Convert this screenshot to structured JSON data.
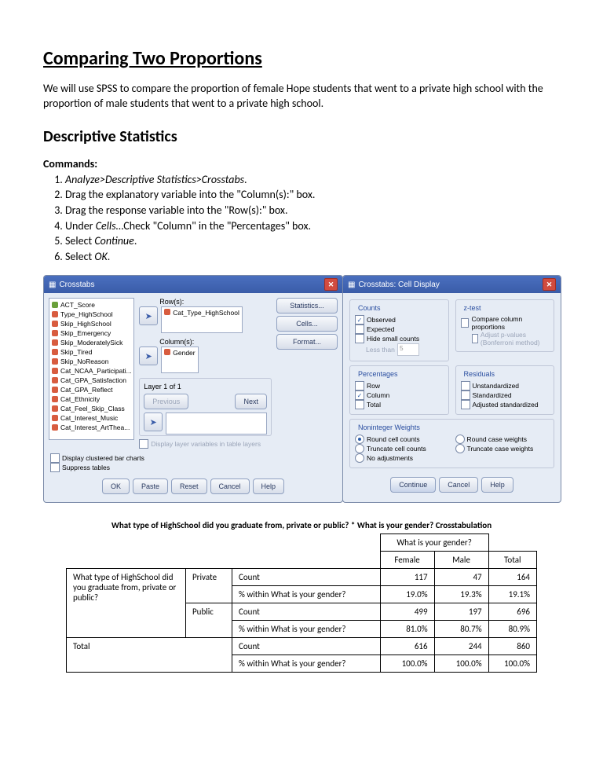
{
  "title": "Comparing Two Proportions",
  "intro": "We will use SPSS to compare the proportion of female Hope students that went to a private high school with the proportion of male students that went to a private high school.",
  "section_heading": "Descriptive Statistics",
  "commands_label": "Commands:",
  "commands": [
    {
      "pre": "",
      "it": "Analyze>Descriptive Statistics>Crosstabs",
      "post": "."
    },
    {
      "pre": "Drag the explanatory variable into the \"Column(s):\" box.",
      "it": "",
      "post": ""
    },
    {
      "pre": "Drag the response variable into the \"Row(s):\" box.",
      "it": "",
      "post": ""
    },
    {
      "pre": "Under ",
      "it": "Cells",
      "post": "…Check \"Column\" in the \"Percentages\" box."
    },
    {
      "pre": "Select ",
      "it": "Continue",
      "post": "."
    },
    {
      "pre": "Select ",
      "it": "OK",
      "post": "."
    }
  ],
  "crosstabs_dialog": {
    "title": "Crosstabs",
    "variables": [
      "ACT_Score",
      "Type_HighSchool",
      "Skip_HighSchool",
      "Skip_Emergency",
      "Skip_ModeratelySick",
      "Skip_Tired",
      "Skip_NoReason",
      "Cat_NCAA_Participati...",
      "Cat_GPA_Satisfaction",
      "Cat_GPA_Reflect",
      "Cat_Ethnicity",
      "Cat_Feel_Skip_Class",
      "Cat_Interest_Music",
      "Cat_Interest_ArtThea..."
    ],
    "rows_label": "Row(s):",
    "rows_value": "Cat_Type_HighSchool",
    "cols_label": "Column(s):",
    "cols_value": "Gender",
    "layer_label": "Layer 1 of 1",
    "btn_prev": "Previous",
    "btn_next": "Next",
    "chk_layer_vars": "Display layer variables in table layers",
    "chk_cluster": "Display clustered bar charts",
    "chk_suppress": "Suppress tables",
    "side_buttons": {
      "stats": "Statistics...",
      "cells": "Cells...",
      "format": "Format..."
    },
    "bottom": {
      "ok": "OK",
      "paste": "Paste",
      "reset": "Reset",
      "cancel": "Cancel",
      "help": "Help"
    }
  },
  "cell_dialog": {
    "title": "Crosstabs: Cell Display",
    "counts_label": "Counts",
    "observed": "Observed",
    "expected": "Expected",
    "hide_small": "Hide small counts",
    "less_than": "Less than",
    "less_than_val": "5",
    "ztest_label": "z-test",
    "compare_cols": "Compare column proportions",
    "adjust_p": "Adjust p-values (Bonferroni method)",
    "pct_label": "Percentages",
    "row": "Row",
    "column": "Column",
    "total": "Total",
    "resid_label": "Residuals",
    "unstd": "Unstandardized",
    "std": "Standardized",
    "adj_std": "Adjusted standardized",
    "weights_label": "Noninteger Weights",
    "round_cell": "Round cell counts",
    "round_case": "Round case weights",
    "trunc_cell": "Truncate cell counts",
    "trunc_case": "Truncate case weights",
    "no_adj": "No adjustments",
    "continue": "Continue",
    "cancel": "Cancel",
    "help": "Help"
  },
  "table": {
    "title": "What type of HighSchool did you graduate from, private or public? * What is your gender? Crosstabulation",
    "header_group": "What is your gender?",
    "col_female": "Female",
    "col_male": "Male",
    "col_total": "Total",
    "row_var_label": "What type of HighSchool did you graduate from, private or public?",
    "total_label": "Total",
    "private_label": "Private",
    "public_label": "Public",
    "count_label": "Count",
    "pct_label": "% within What is your gender?",
    "data": {
      "private_count": {
        "f": "117",
        "m": "47",
        "t": "164"
      },
      "private_pct": {
        "f": "19.0%",
        "m": "19.3%",
        "t": "19.1%"
      },
      "public_count": {
        "f": "499",
        "m": "197",
        "t": "696"
      },
      "public_pct": {
        "f": "81.0%",
        "m": "80.7%",
        "t": "80.9%"
      },
      "total_count": {
        "f": "616",
        "m": "244",
        "t": "860"
      },
      "total_pct": {
        "f": "100.0%",
        "m": "100.0%",
        "t": "100.0%"
      }
    }
  }
}
